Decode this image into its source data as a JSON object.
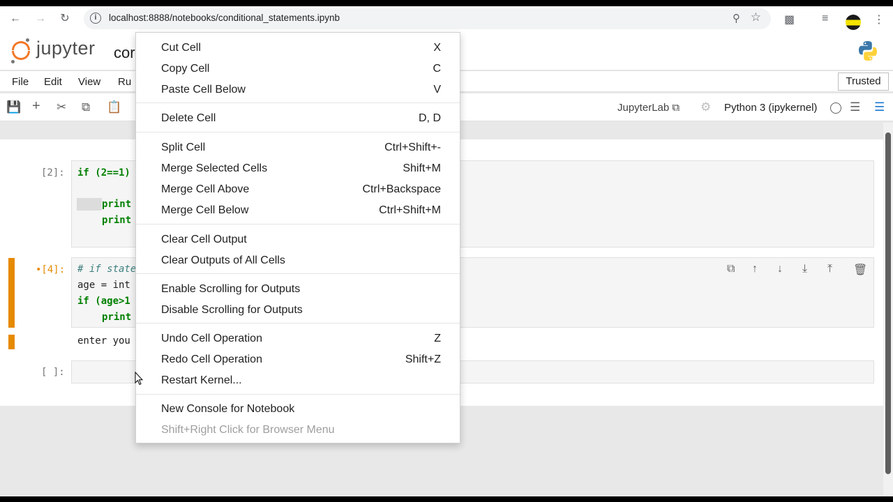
{
  "browser": {
    "url": "localhost:8888/notebooks/conditional_statements.ipynb"
  },
  "header": {
    "logo_text": "jupyter",
    "notebook_name": "cor"
  },
  "menubar": {
    "items": [
      "File",
      "Edit",
      "View",
      "Ru"
    ],
    "trusted": "Trusted"
  },
  "toolbar": {
    "jupyterlab_link": "JupyterLab",
    "kernel": "Python 3 (ipykernel)"
  },
  "cells": [
    {
      "prompt": "[2]:",
      "lines": [
        "if (2==1)",
        "print",
        "print"
      ]
    },
    {
      "prompt": "•[4]:",
      "lines": [
        "# if state",
        "age = int",
        "if (age>1",
        "print"
      ],
      "output": "enter you"
    },
    {
      "prompt": "[ ]:"
    }
  ],
  "context_menu": {
    "items": [
      {
        "label": "Cut Cell",
        "key": "X"
      },
      {
        "label": "Copy Cell",
        "key": "C"
      },
      {
        "label": "Paste Cell Below",
        "key": "V"
      },
      {
        "label": "Delete Cell",
        "key": "D, D"
      },
      {
        "label": "Split Cell",
        "key": "Ctrl+Shift+-"
      },
      {
        "label": "Merge Selected Cells",
        "key": "Shift+M"
      },
      {
        "label": "Merge Cell Above",
        "key": "Ctrl+Backspace"
      },
      {
        "label": "Merge Cell Below",
        "key": "Ctrl+Shift+M"
      },
      {
        "label": "Clear Cell Output",
        "key": ""
      },
      {
        "label": "Clear Outputs of All Cells",
        "key": ""
      },
      {
        "label": "Enable Scrolling for Outputs",
        "key": ""
      },
      {
        "label": "Disable Scrolling for Outputs",
        "key": ""
      },
      {
        "label": "Undo Cell Operation",
        "key": "Z"
      },
      {
        "label": "Redo Cell Operation",
        "key": "Shift+Z"
      },
      {
        "label": "Restart Kernel...",
        "key": ""
      },
      {
        "label": "New Console for Notebook",
        "key": ""
      },
      {
        "label": "Shift+Right Click for Browser Menu",
        "key": ""
      }
    ]
  },
  "colors": {
    "jupyter_orange": "#f37726",
    "selected_cell_bar": "#e68a00",
    "keyword_green": "#008000"
  }
}
